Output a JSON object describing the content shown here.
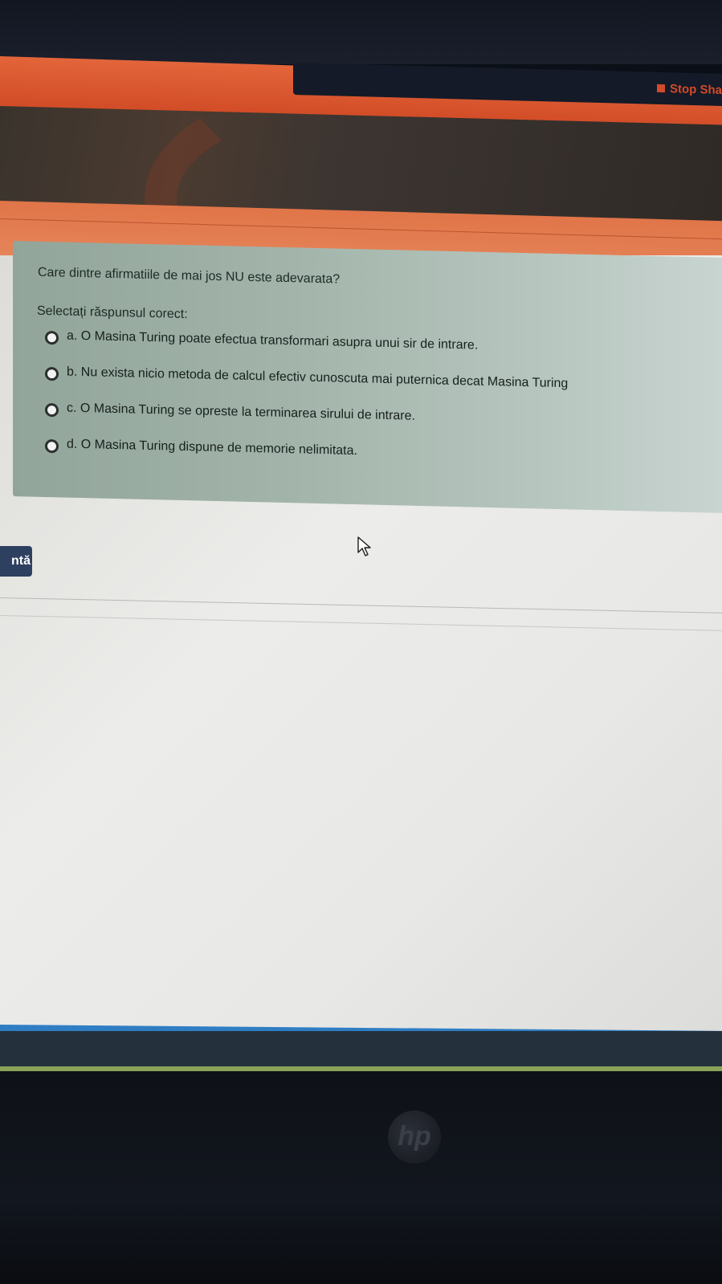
{
  "browser": {
    "share_notice": "",
    "stop_share_label": "Stop Sha"
  },
  "quiz": {
    "question": "Care dintre afirmatiile de mai jos NU este adevarata?",
    "prompt": "Selectați răspunsul corect:",
    "answers": [
      {
        "label": "a. O Masina Turing poate efectua transformari asupra unui sir de intrare."
      },
      {
        "label": "b. Nu exista nicio metoda de calcul efectiv cunoscuta mai puternica decat Masina Turing"
      },
      {
        "label": "c. O Masina Turing se opreste la terminarea sirului de intrare."
      },
      {
        "label": "d. O Masina Turing dispune de memorie nelimitata."
      }
    ],
    "next_button_label": "ntă"
  },
  "device": {
    "logo": "hp"
  },
  "colors": {
    "header_orange": "#d24d27",
    "panel_green": "#a3b5ab",
    "button_navy": "#2e4060",
    "accent_blue": "#2f7ec4"
  }
}
